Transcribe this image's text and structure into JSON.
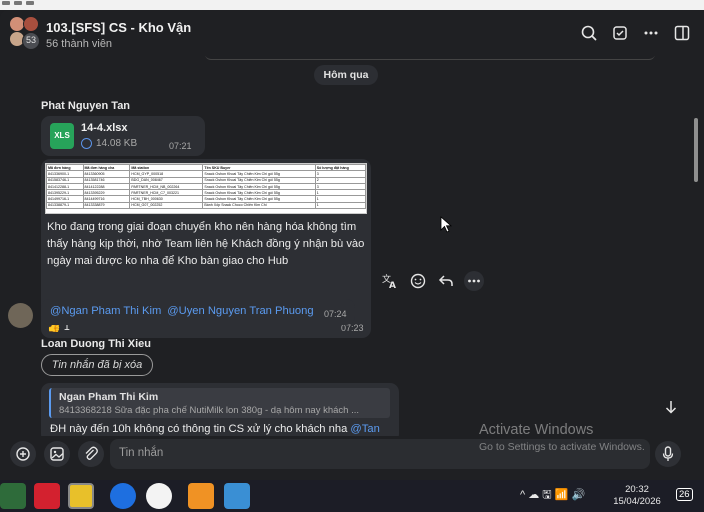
{
  "header": {
    "title": "103.[SFS] CS - Kho Vận",
    "member_badge": "53",
    "subtitle": "56 thành viên"
  },
  "chat": {
    "date_separator": "Hôm qua",
    "messages": [
      {
        "sender": "Phat Nguyen Tan",
        "file": {
          "name": "14-4.xlsx",
          "size": "14.08 KB",
          "time": "07:21",
          "icon": "XLS"
        },
        "sheet_rows": [
          [
            "Mã đơn hàng",
            "Mã đơn hàng cha",
            "Mã station",
            "Tên SKU Buyer",
            "Số lượng đặt hàng"
          ],
          [
            "841336900-1",
            "8413360905",
            "HCM_GYP_000518",
            "Snack Oshon Khoai Tây Chiên Kim Chi gói 55g",
            "3"
          ],
          [
            "841583746-1",
            "8413581746",
            "BDG_DAN_008467",
            "Snack Oshon Khoai Tây Chiên Kim Chi gói 55g",
            "2"
          ],
          [
            "841412288-1",
            "8414122288",
            "PARTNER_HCM_NB_002264",
            "Snack Oshon Khoai Tây Chiên Kim Chi gói 55g",
            "3"
          ],
          [
            "841395229-1",
            "8413395229",
            "PARTNER_HCM_C7_003221",
            "Snack Oshon Khoai Tây Chiên Kim Chi gói 55g",
            "1"
          ],
          [
            "841499716-1",
            "8414499716",
            "HCM_TBH_000630",
            "Snack Oshon Khoai Tây Chiên Kim Chi gói 55g",
            "1"
          ],
          [
            "841338879-1",
            "8413338879",
            "HCM_G07_002252",
            "Bánh Xốp Snack Choco Chiên Kim Chi",
            "1"
          ]
        ],
        "text": "Kho đang trong giai đoạn chuyển kho nên hàng hóa không tìm thấy hàng kịp thời, nhờ Team liên hệ Khách đồng ý nhận bù vào ngày mai được ko nha để Kho bàn giao cho Hub",
        "reaction": "👍 1",
        "time": "07:23"
      },
      {
        "mention1": "@Ngan Pham Thi Kim",
        "mention2": "@Uyen Nguyen Tran Phuong",
        "time": "07:24"
      },
      {
        "sender": "Loan Duong Thi Xieu",
        "recalled": "Tin nhắn đã bị xóa"
      },
      {
        "quote_name": "Ngan Pham Thi Kim",
        "quote_text": "8413368218 Sữa đặc pha chế NutiMilk lon 380g - dạ hôm nay khách ...",
        "text": "ĐH này đến 10h không có thông tin CS xử lý cho khách nha",
        "mention": "@Tan"
      }
    ]
  },
  "input": {
    "placeholder": "Tin nhắn"
  },
  "watermark": {
    "line1": "Activate Windows",
    "line2": "Go to Settings to activate Windows."
  },
  "taskbar": {
    "time": "20:32",
    "date": "15/04/2026",
    "notifications": "26"
  },
  "colors": {
    "accent": "#5b9bf0",
    "background": "#1f2023",
    "bubble": "#2d2f34",
    "xls": "#27a35a"
  }
}
